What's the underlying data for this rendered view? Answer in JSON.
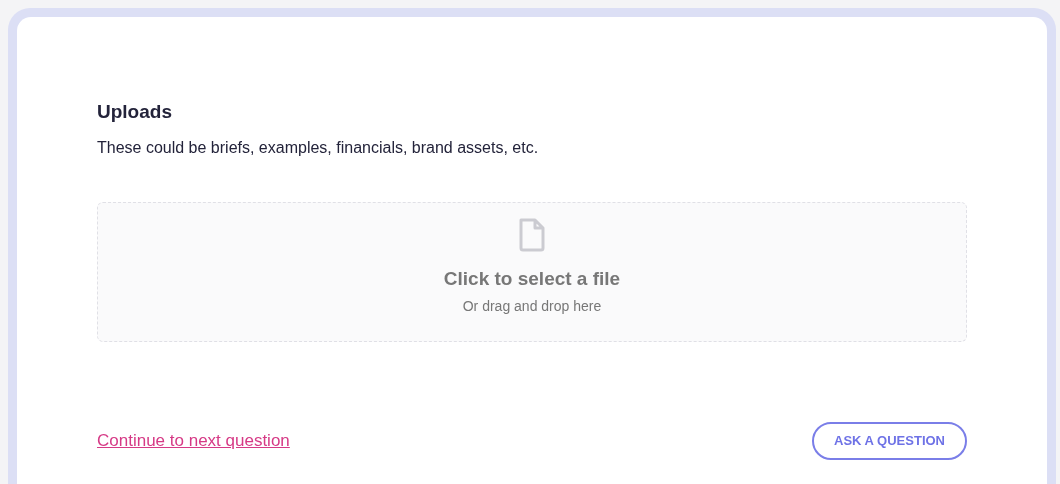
{
  "section": {
    "title": "Uploads",
    "description": "These could be briefs, examples, financials, brand assets, etc."
  },
  "dropzone": {
    "title": "Click to select a file",
    "hint": "Or drag and drop here"
  },
  "footer": {
    "link": "Continue to next question",
    "button": "ASK A QUESTION"
  }
}
